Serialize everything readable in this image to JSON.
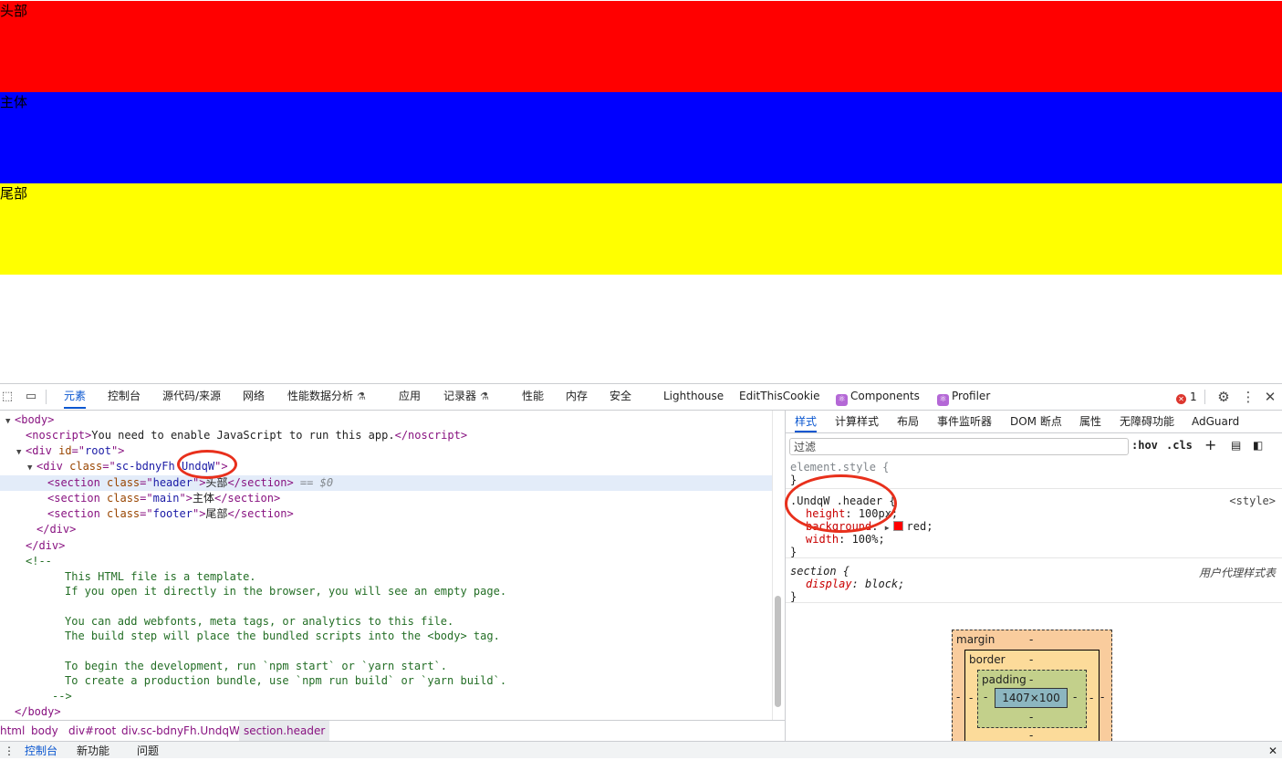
{
  "page": {
    "header_text": "头部",
    "main_text": "主体",
    "footer_text": "尾部"
  },
  "devtools": {
    "tabs": [
      "元素",
      "控制台",
      "源代码/来源",
      "网络",
      "性能数据分析",
      "应用",
      "记录器",
      "性能",
      "内存",
      "安全",
      "Lighthouse",
      "EditThisCookie",
      "Components",
      "Profiler"
    ],
    "experimental_mark": "⚗",
    "error_count": "1",
    "error_glyph": "✕",
    "elements": {
      "body_open": "<body>",
      "noscript_text": "You need to enable JavaScript to run this app.",
      "root_id": "root",
      "wrapper_class_a": "sc-bdnyFh",
      "wrapper_class_b": "UndqW",
      "header_class": "header",
      "header_text": "头部",
      "main_class": "main",
      "main_text": "主体",
      "footer_class": "footer",
      "footer_text": "尾部",
      "selected_marker": "== $0",
      "comment_lines": [
        "This HTML file is a template.",
        "If you open it directly in the browser, you will see an empty page.",
        "You can add webfonts, meta tags, or analytics to this file.",
        "The build step will place the bundled scripts into the <body> tag.",
        "To begin the development, run `npm start` or `yarn start`.",
        "To create a production bundle, use `npm run build` or `yarn build`."
      ]
    },
    "breadcrumbs": [
      "html",
      "body",
      "div#root",
      "div.sc-bdnyFh.UndqW",
      "section.header"
    ],
    "drawer_tabs": [
      "控制台",
      "新功能",
      "问题"
    ],
    "styles_tabs": [
      "样式",
      "计算样式",
      "布局",
      "事件监听器",
      "DOM 断点",
      "属性",
      "无障碍功能",
      "AdGuard"
    ],
    "filter_placeholder": "过滤",
    "hov_label": ":hov",
    "cls_label": ".cls",
    "rules": {
      "element_style": "element.style {",
      "close": "}",
      "header_selector": ".UndqW .header {",
      "header_source": "<style>",
      "header_props": [
        {
          "name": "height",
          "value": "100px;"
        },
        {
          "name": "background",
          "value": "red;"
        },
        {
          "name": "width",
          "value": "100%;"
        }
      ],
      "section_selector": "section {",
      "section_source": "用户代理样式表",
      "section_prop": {
        "name": "display",
        "value": "block;"
      }
    },
    "box_model": {
      "margin_label": "margin",
      "border_label": "border",
      "padding_label": "padding",
      "content_size": "1407×100",
      "dash": "-"
    }
  },
  "colors": {
    "header_bg": "#ff0000",
    "main_bg": "#0000ff",
    "footer_bg": "#ffff00",
    "accent": "#0b57d0",
    "annotation": "#e8301c"
  }
}
